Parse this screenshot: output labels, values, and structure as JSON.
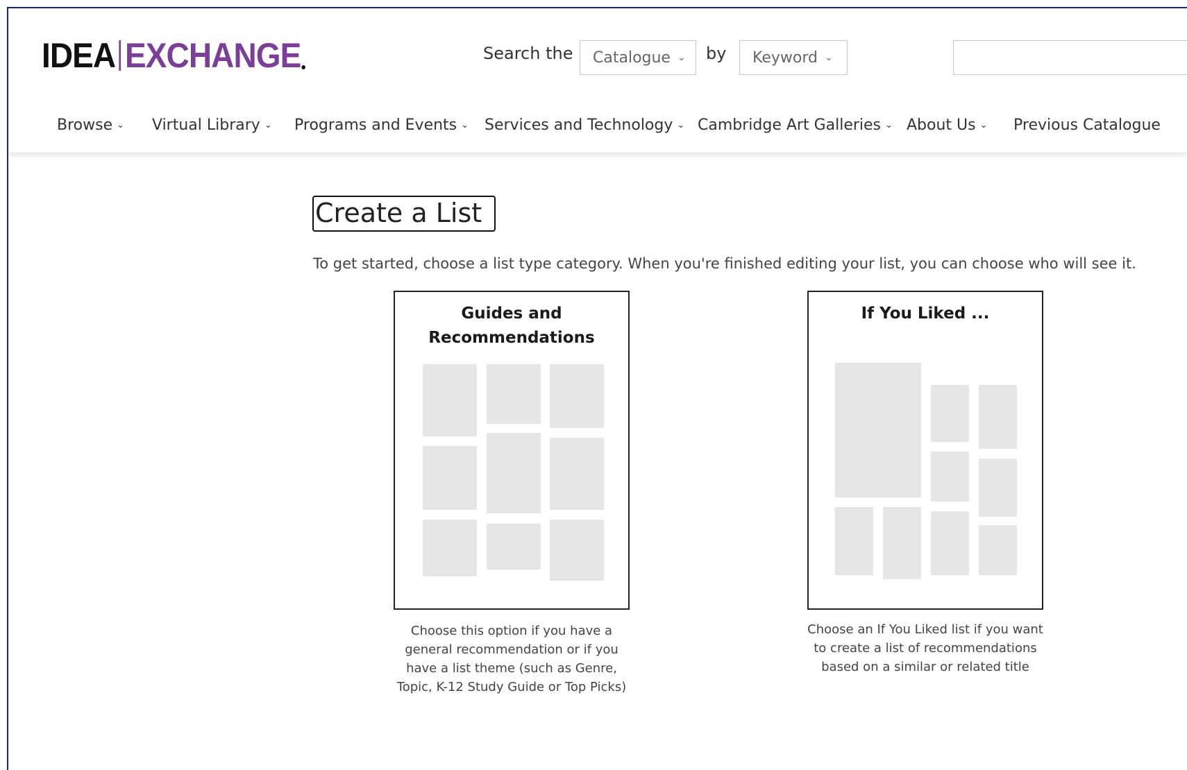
{
  "logo": {
    "part1": "IDEA",
    "part2": "EXCHANGE"
  },
  "search": {
    "label_search_the": "Search the",
    "scope_value": "Catalogue",
    "label_by": "by",
    "field_value": "Keyword",
    "query": ""
  },
  "nav": {
    "items": [
      {
        "label": "Browse",
        "has_menu": true
      },
      {
        "label": "Virtual Library",
        "has_menu": true
      },
      {
        "label": "Programs and Events",
        "has_menu": true
      },
      {
        "label": "Services and Technology",
        "has_menu": true
      },
      {
        "label": "Cambridge Art Galleries",
        "has_menu": true
      },
      {
        "label": "About Us",
        "has_menu": true
      },
      {
        "label": "Previous Catalogue",
        "has_menu": false
      }
    ]
  },
  "page": {
    "title": "Create a List",
    "intro": "To get started, choose a list type category. When you're finished editing your list, you can choose who will see it."
  },
  "cards": [
    {
      "title_line1": "Guides and",
      "title_line2": "Recommendations",
      "description": "Choose this option if you have a general recommendation or if you have a list theme (such as Genre, Topic, K-12 Study Guide or Top Picks)"
    },
    {
      "title_line1": "If You Liked ...",
      "title_line2": "",
      "description": "Choose an If You Liked list if you want to create a list of recommendations based on a similar or related title"
    }
  ],
  "colors": {
    "brand_purple": "#7b3f98",
    "frame_navy": "#1f2a5c",
    "placeholder_gray": "#e6e6e6"
  },
  "icons": {
    "dropdown": "chevron-down-icon"
  }
}
